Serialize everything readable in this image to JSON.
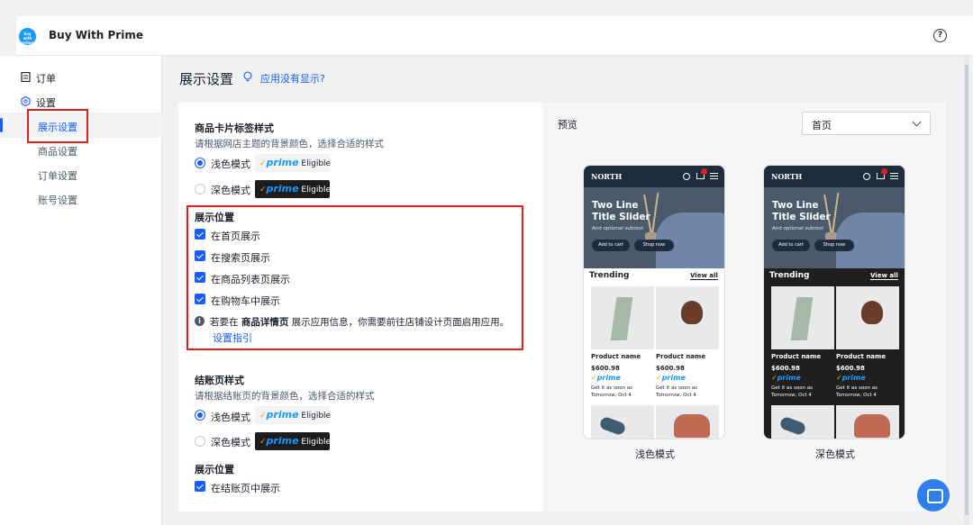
{
  "app": {
    "brand": "Buy With Prime",
    "logo_text": "buy with prime"
  },
  "sidebar": {
    "items": [
      {
        "label": "订单"
      },
      {
        "label": "设置"
      }
    ],
    "sub_items": [
      {
        "label": "展示设置",
        "active": true
      },
      {
        "label": "商品设置"
      },
      {
        "label": "订单设置"
      },
      {
        "label": "账号设置"
      }
    ]
  },
  "page": {
    "title": "展示设置",
    "no_show_link": "应用没有显示?"
  },
  "card_style": {
    "heading": "商品卡片标签样式",
    "desc": "请根据网店主题的背景颜色，选择合适的样式",
    "light_label": "浅色模式",
    "dark_label": "深色模式",
    "selected": "light",
    "badge_prime": "prime",
    "badge_eligible": "Eligible"
  },
  "display_position": {
    "heading": "展示位置",
    "options": [
      {
        "label": "在首页展示",
        "checked": true
      },
      {
        "label": "在搜索页展示",
        "checked": true
      },
      {
        "label": "在商品列表页展示",
        "checked": true
      },
      {
        "label": "在购物车中展示",
        "checked": true
      }
    ],
    "note_prefix": "若要在",
    "note_bold": "商品详情页",
    "note_suffix": "展示应用信息，你需要前往店铺设计页面启用应用。",
    "guide_link": "设置指引"
  },
  "checkout_style": {
    "heading": "结账页样式",
    "desc": "请根据结账页的背景颜色，选择合适的样式",
    "light_label": "浅色模式",
    "dark_label": "深色模式",
    "selected": "light"
  },
  "checkout_position": {
    "heading": "展示位置",
    "option": {
      "label": "在结账页中展示",
      "checked": true
    }
  },
  "preview": {
    "label": "预览",
    "page_select": "首页",
    "light_caption": "浅色模式",
    "dark_caption": "深色模式",
    "phone": {
      "logo": "NORTH",
      "cart_count": "1",
      "hero_line1": "Two Line",
      "hero_line2": "Title Slider",
      "hero_sub": "And optional subtext",
      "btn_cart": "Add to cart",
      "btn_shop": "Shop now",
      "trending": "Trending",
      "view_all": "View all",
      "product_name": "Product name",
      "price": "$600.98",
      "prime": "prime",
      "get_it": "Get it as soon as",
      "delivery": "Tomorrow, Oct 4"
    }
  },
  "colors": {
    "accent": "#165dff",
    "highlight_box": "#e02020",
    "prime_blue": "#1a98ff",
    "prime_check": "#f4a300"
  }
}
